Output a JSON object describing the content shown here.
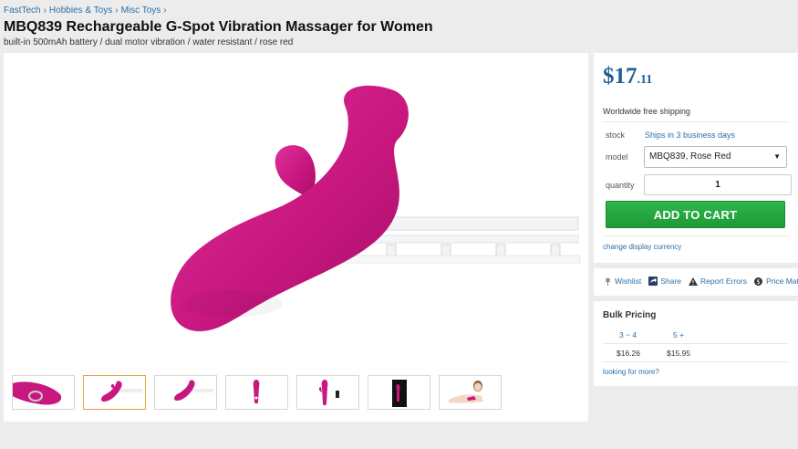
{
  "breadcrumb": {
    "items": [
      "FastTech",
      "Hobbies & Toys",
      "Misc Toys"
    ],
    "separator": "›"
  },
  "product": {
    "title": "MBQ839 Rechargeable G-Spot Vibration Massager for Women",
    "subtitle": "built-in 500mAh battery / dual motor vibration / water resistant / rose red",
    "color": "#c8177f"
  },
  "gallery": {
    "thumbnail_count": 7,
    "active_thumbnail": 2
  },
  "purchase": {
    "price_main": "$17",
    "price_cents": ".11",
    "shipping": "Worldwide free shipping",
    "stock_label": "stock",
    "stock_value": "Ships in 3 business days",
    "model_label": "model",
    "model_value": "MBQ839, Rose Red",
    "quantity_label": "quantity",
    "quantity_value": "1",
    "add_to_cart": "ADD TO CART",
    "change_currency": "change display currency"
  },
  "actions": {
    "wishlist": "Wishlist",
    "share": "Share",
    "report": "Report Errors",
    "price_match": "Price Match"
  },
  "bulk": {
    "title": "Bulk Pricing",
    "tiers": [
      {
        "range": "3 ~ 4",
        "price": "$16.26"
      },
      {
        "range": "5 +",
        "price": "$15.95"
      }
    ],
    "more": "looking for more?"
  },
  "colors": {
    "link": "#2a6fa8",
    "price": "#1f5f9a",
    "cart_button": "#28a745",
    "product": "#c8177f"
  }
}
